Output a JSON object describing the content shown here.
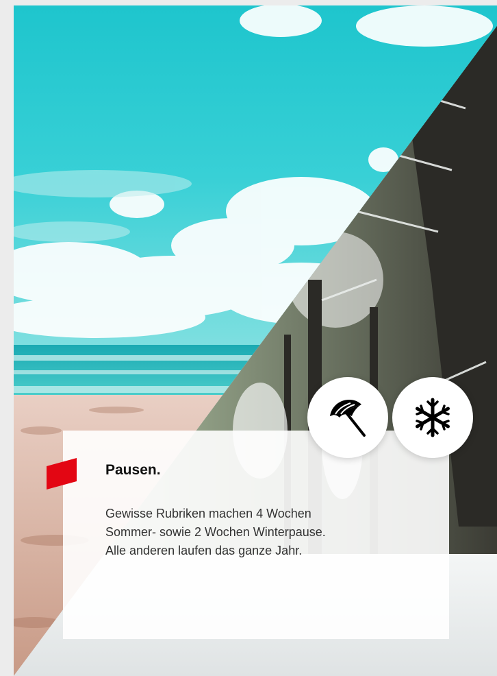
{
  "card": {
    "title": "Pausen.",
    "lines": [
      "Gewisse Rubriken machen 4 Wochen",
      "Sommer- sowie 2 Wochen Winterpause.",
      "Alle anderen laufen das ganze Jahr."
    ]
  },
  "icons": {
    "summer": "beach-umbrella-icon",
    "winter": "snowflake-icon"
  },
  "colors": {
    "accent": "#e30613",
    "card": "#ffffff"
  }
}
